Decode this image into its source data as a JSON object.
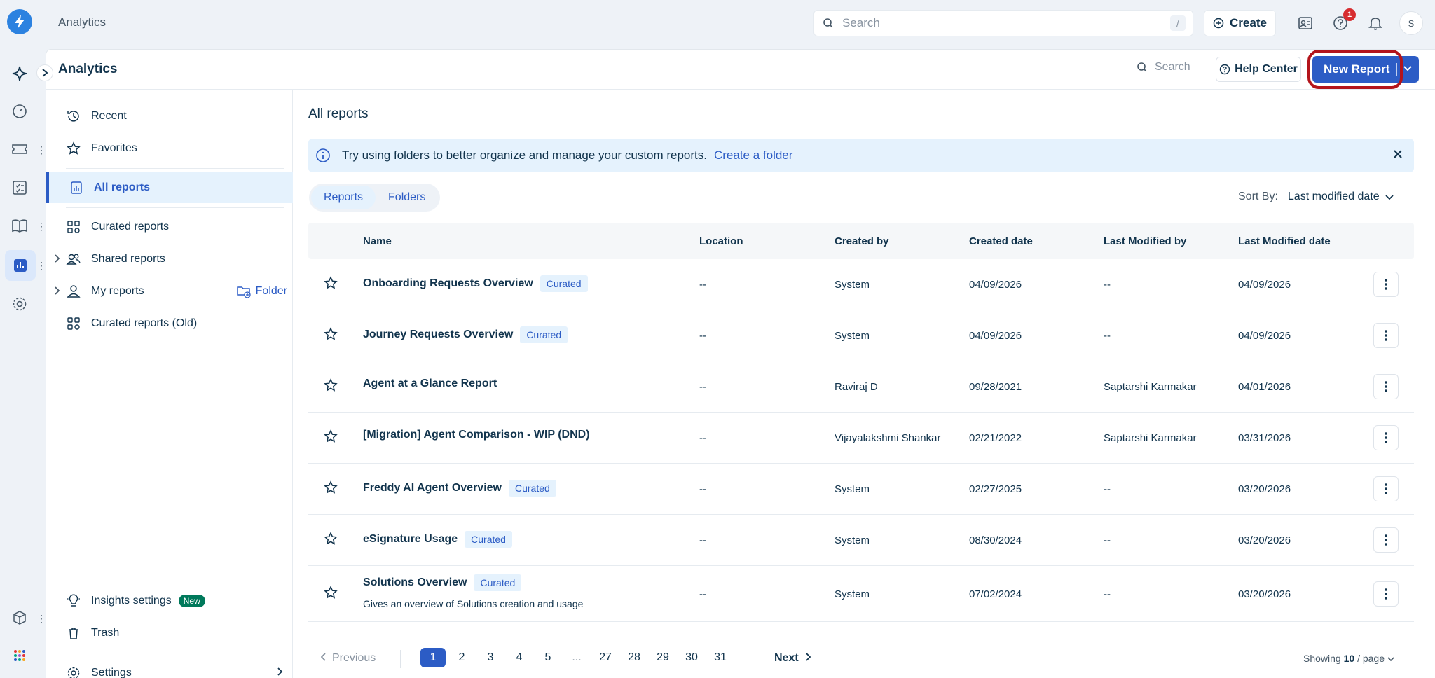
{
  "topbar": {
    "title": "Analytics",
    "search_placeholder": "Search",
    "search_shortcut": "/",
    "create_label": "Create",
    "notification_count": "1",
    "avatar_initial": "S"
  },
  "panel": {
    "title": "Analytics",
    "search_label": "Search",
    "help_label": "Help Center",
    "new_report_label": "New Report"
  },
  "sidebar": {
    "items": [
      {
        "label": "Recent",
        "icon": "history-icon"
      },
      {
        "label": "Favorites",
        "icon": "star-icon"
      },
      {
        "label": "All reports",
        "icon": "reports-icon"
      },
      {
        "label": "Curated reports",
        "icon": "grid-icon"
      },
      {
        "label": "Shared reports",
        "icon": "users-icon"
      },
      {
        "label": "My reports",
        "icon": "user-icon"
      },
      {
        "label": "Curated reports (Old)",
        "icon": "grid-icon"
      }
    ],
    "folder_label": "Folder",
    "insights_label": "Insights settings",
    "new_badge": "New",
    "trash_label": "Trash",
    "settings_label": "Settings"
  },
  "content": {
    "title": "All reports",
    "banner_text": "Try using folders to better organize and manage your custom reports.",
    "banner_link": "Create a folder",
    "tabs": [
      "Reports",
      "Folders"
    ],
    "sort_label": "Sort By:",
    "sort_value": "Last modified date"
  },
  "table": {
    "headers": [
      "Name",
      "Location",
      "Created by",
      "Created date",
      "Last Modified by",
      "Last Modified date"
    ],
    "rows": [
      {
        "name": "Onboarding Requests Overview",
        "badge": "Curated",
        "desc": "",
        "location": "--",
        "created_by": "System",
        "created_date": "04/09/2026",
        "modified_by": "--",
        "modified_date": "04/09/2026"
      },
      {
        "name": "Journey Requests Overview",
        "badge": "Curated",
        "desc": "",
        "location": "--",
        "created_by": "System",
        "created_date": "04/09/2026",
        "modified_by": "--",
        "modified_date": "04/09/2026"
      },
      {
        "name": "Agent at a Glance Report",
        "badge": "",
        "desc": "",
        "location": "--",
        "created_by": "Raviraj D",
        "created_date": "09/28/2021",
        "modified_by": "Saptarshi Karmakar",
        "modified_date": "04/01/2026"
      },
      {
        "name": "[Migration] Agent Comparison - WIP (DND)",
        "badge": "",
        "desc": "",
        "location": "--",
        "created_by": "Vijayalakshmi Shankar",
        "created_date": "02/21/2022",
        "modified_by": "Saptarshi Karmakar",
        "modified_date": "03/31/2026"
      },
      {
        "name": "Freddy AI Agent Overview",
        "badge": "Curated",
        "desc": "",
        "location": "--",
        "created_by": "System",
        "created_date": "02/27/2025",
        "modified_by": "--",
        "modified_date": "03/20/2026"
      },
      {
        "name": "eSignature Usage",
        "badge": "Curated",
        "desc": "",
        "location": "--",
        "created_by": "System",
        "created_date": "08/30/2024",
        "modified_by": "--",
        "modified_date": "03/20/2026"
      },
      {
        "name": "Solutions Overview",
        "badge": "Curated",
        "desc": "Gives an overview of Solutions creation and usage",
        "location": "--",
        "created_by": "System",
        "created_date": "07/02/2024",
        "modified_by": "--",
        "modified_date": "03/20/2026"
      }
    ]
  },
  "pagination": {
    "previous_label": "Previous",
    "pages": [
      "1",
      "2",
      "3",
      "4",
      "5",
      "...",
      "27",
      "28",
      "29",
      "30",
      "31"
    ],
    "current_page": "1",
    "next_label": "Next",
    "showing_prefix": "Showing",
    "showing_count": "10",
    "showing_suffix": "/ page"
  },
  "colors": {
    "accent": "#2c5cc5",
    "highlight": "#b3141b",
    "badge_bg": "#e5f2fd",
    "new_badge": "#00795b"
  }
}
